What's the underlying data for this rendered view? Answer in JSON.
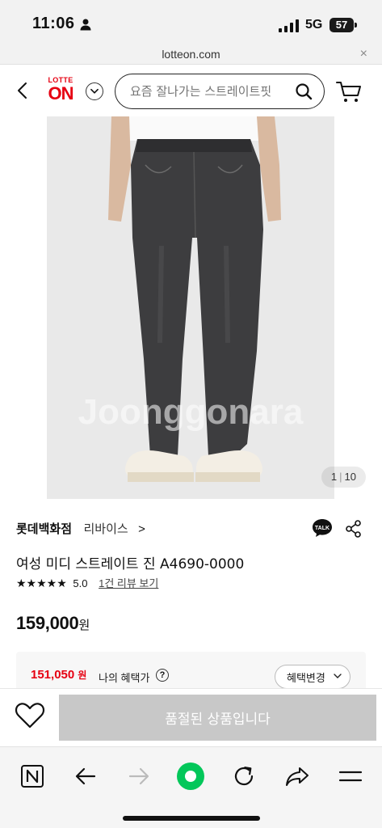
{
  "status_bar": {
    "time": "11:06",
    "network": "5G",
    "battery": "57"
  },
  "url_bar": {
    "url": "lotteon.com",
    "close": "×"
  },
  "header": {
    "logo_top": "LOTTE",
    "logo_main": "ON",
    "search_placeholder": "요즘 잘나가는 스트레이트핏",
    "colors": {
      "brand": "#e60012"
    }
  },
  "product_image": {
    "watermark": "Joonggonara",
    "counter_current": "1",
    "counter_total": "10"
  },
  "product": {
    "store": "롯데백화점",
    "brand": "리바이스",
    "brand_chevron": ">",
    "title": "여성 미디 스트레이트 진 A4690-0000",
    "rating_stars": "★★★★★",
    "rating": "5.0",
    "review_link": "1건 리뷰 보기",
    "price": "159,000",
    "price_unit": "원",
    "talk_label": "TALK"
  },
  "benefit": {
    "price": "151,050",
    "unit": "원",
    "label": "나의 혜택가",
    "help": "?",
    "change_button": "혜택변경"
  },
  "actions": {
    "soldout_label": "품절된 상품입니다"
  },
  "bottom_nav": {
    "items": [
      "N-icon",
      "back-arrow-icon",
      "forward-arrow-icon",
      "home-circle-icon",
      "refresh-icon",
      "share-icon",
      "menu-icon"
    ]
  }
}
